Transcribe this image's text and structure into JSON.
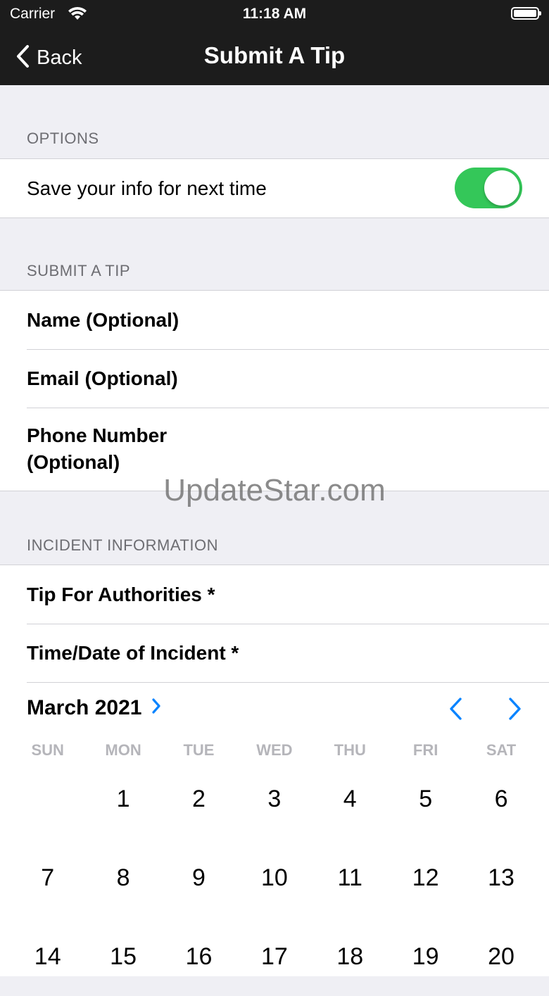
{
  "status_bar": {
    "carrier": "Carrier",
    "time": "11:18 AM"
  },
  "nav": {
    "back_label": "Back",
    "title": "Submit A Tip"
  },
  "options": {
    "header": "OPTIONS",
    "save_info_label": "Save your info for next time",
    "save_info_on": true
  },
  "submit": {
    "header": "SUBMIT A TIP",
    "fields": [
      "Name (Optional)",
      "Email (Optional)",
      "Phone Number\n(Optional)"
    ]
  },
  "watermark": "UpdateStar.com",
  "incident": {
    "header": "INCIDENT INFORMATION",
    "fields": [
      "Tip For Authorities *",
      "Time/Date of Incident *"
    ]
  },
  "calendar": {
    "month_label": "March 2021",
    "weekdays": [
      "SUN",
      "MON",
      "TUE",
      "WED",
      "THU",
      "FRI",
      "SAT"
    ],
    "weeks": [
      [
        "",
        "1",
        "2",
        "3",
        "4",
        "5",
        "6"
      ],
      [
        "7",
        "8",
        "9",
        "10",
        "11",
        "12",
        "13"
      ],
      [
        "14",
        "15",
        "16",
        "17",
        "18",
        "19",
        "20"
      ]
    ]
  },
  "colors": {
    "accent": "#0a84ff",
    "toggle_on": "#34c759",
    "nav_bg": "#1c1c1c"
  },
  "icons": {
    "back": "chevron-left-icon",
    "month_expand": "chevron-right-icon",
    "prev": "chevron-left-icon",
    "next": "chevron-right-icon"
  }
}
